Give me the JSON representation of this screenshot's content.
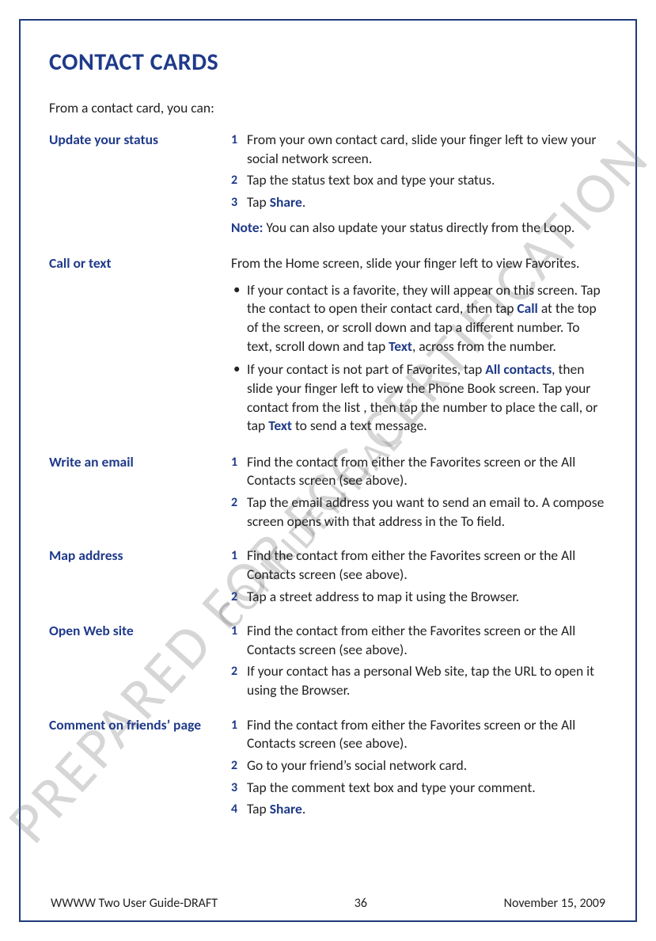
{
  "watermark1": "PREPARED FOR FCC CERTIFICATION",
  "watermark2": "CONFIDENTIAL",
  "title": "CONTACT CARDS",
  "intro": "From a contact card, you can:",
  "sections": {
    "update": {
      "label": "Update your status",
      "steps": [
        "From your own contact card, slide your finger left to view your social network screen.",
        "Tap the status text box and type your status."
      ],
      "step3_pre": "Tap ",
      "step3_kw": "Share",
      "step3_post": ".",
      "note_label": "Note:",
      "note_text": " You can also update your status directly from the Loop."
    },
    "call": {
      "label": "Call or text",
      "lead": "From the Home screen, slide your finger left to view Favorites.",
      "b1_a": "If your contact is a favorite, they will appear on this screen. Tap the contact to open their contact card, then tap ",
      "b1_kw1": "Call",
      "b1_b": " at the top of the screen, or scroll down and tap a different number. To text, scroll down and tap ",
      "b1_kw2": "Text",
      "b1_c": ", across from the number.",
      "b2_a": "If your contact is not part of Favorites, tap ",
      "b2_kw1": "All contacts",
      "b2_b": ", then slide your finger left to view the Phone Book screen. Tap your contact from the list , then tap the number to place the call, or tap ",
      "b2_kw2": "Text",
      "b2_c": " to send a text message."
    },
    "email": {
      "label": "Write an email",
      "s1": "Find the contact from either the Favorites screen or the All Contacts screen (see above).",
      "s2": "Tap the email address you want to send an email to. A compose screen opens with that address in the To field."
    },
    "map": {
      "label": "Map address",
      "s1": "Find the contact from either the Favorites screen or the All Contacts screen (see above).",
      "s2": "Tap a street address to map it using the Browser."
    },
    "web": {
      "label": "Open Web site",
      "s1": "Find the contact from either the Favorites screen or the All Contacts screen (see above).",
      "s2": "If your contact has a personal Web site, tap the URL to open it using the Browser."
    },
    "comment": {
      "label": "Comment on friends’ page",
      "s1": "Find the contact from either the Favorites screen or the All Contacts screen (see above).",
      "s2": "Go to your friend’s social network card.",
      "s3": "Tap the comment text box and type your comment.",
      "s4_pre": "Tap ",
      "s4_kw": "Share",
      "s4_post": "."
    }
  },
  "footer": {
    "left": "WWWW Two User Guide-DRAFT",
    "center": "36",
    "right": "November 15, 2009"
  }
}
